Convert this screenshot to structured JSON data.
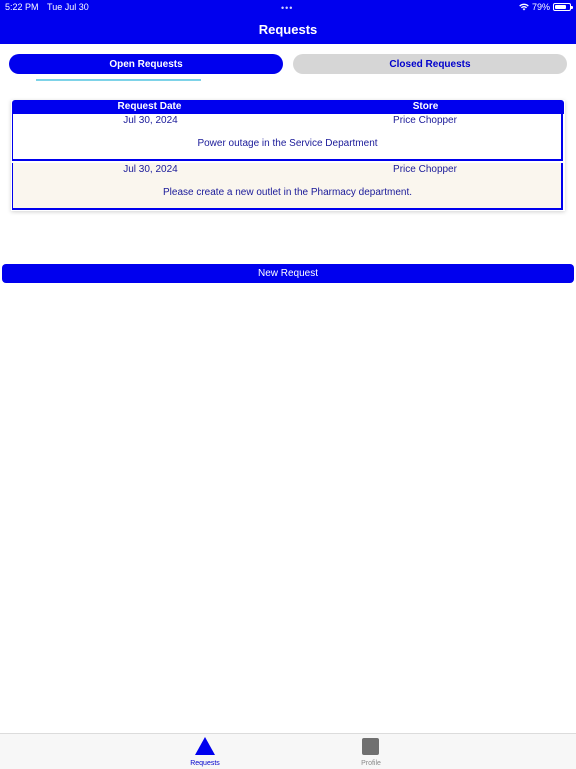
{
  "status_bar": {
    "time": "5:22 PM",
    "date": "Tue Jul 30",
    "dots": "•••",
    "battery": "79%"
  },
  "nav": {
    "title": "Requests"
  },
  "segments": {
    "open_label": "Open Requests",
    "closed_label": "Closed Requests",
    "selected": "Open Requests"
  },
  "table": {
    "headers": [
      "Request Date",
      "Store"
    ],
    "rows": [
      {
        "date": "Jul 30, 2024",
        "store": "Price Chopper",
        "description": "Power outage in the Service Department"
      },
      {
        "date": "Jul 30, 2024",
        "store": "Price Chopper",
        "description": "Please create a new outlet in the Pharmacy department."
      }
    ]
  },
  "actions": {
    "new_request_label": "New Request"
  },
  "tabbar": {
    "items": [
      {
        "label": "Requests",
        "icon": "triangle-icon",
        "active": true
      },
      {
        "label": "Profile",
        "icon": "square-icon",
        "active": false
      }
    ]
  },
  "colors": {
    "accent": "#0000ee",
    "segment_inactive": "#d6d6d6",
    "row_alt": "#faf6ee"
  }
}
